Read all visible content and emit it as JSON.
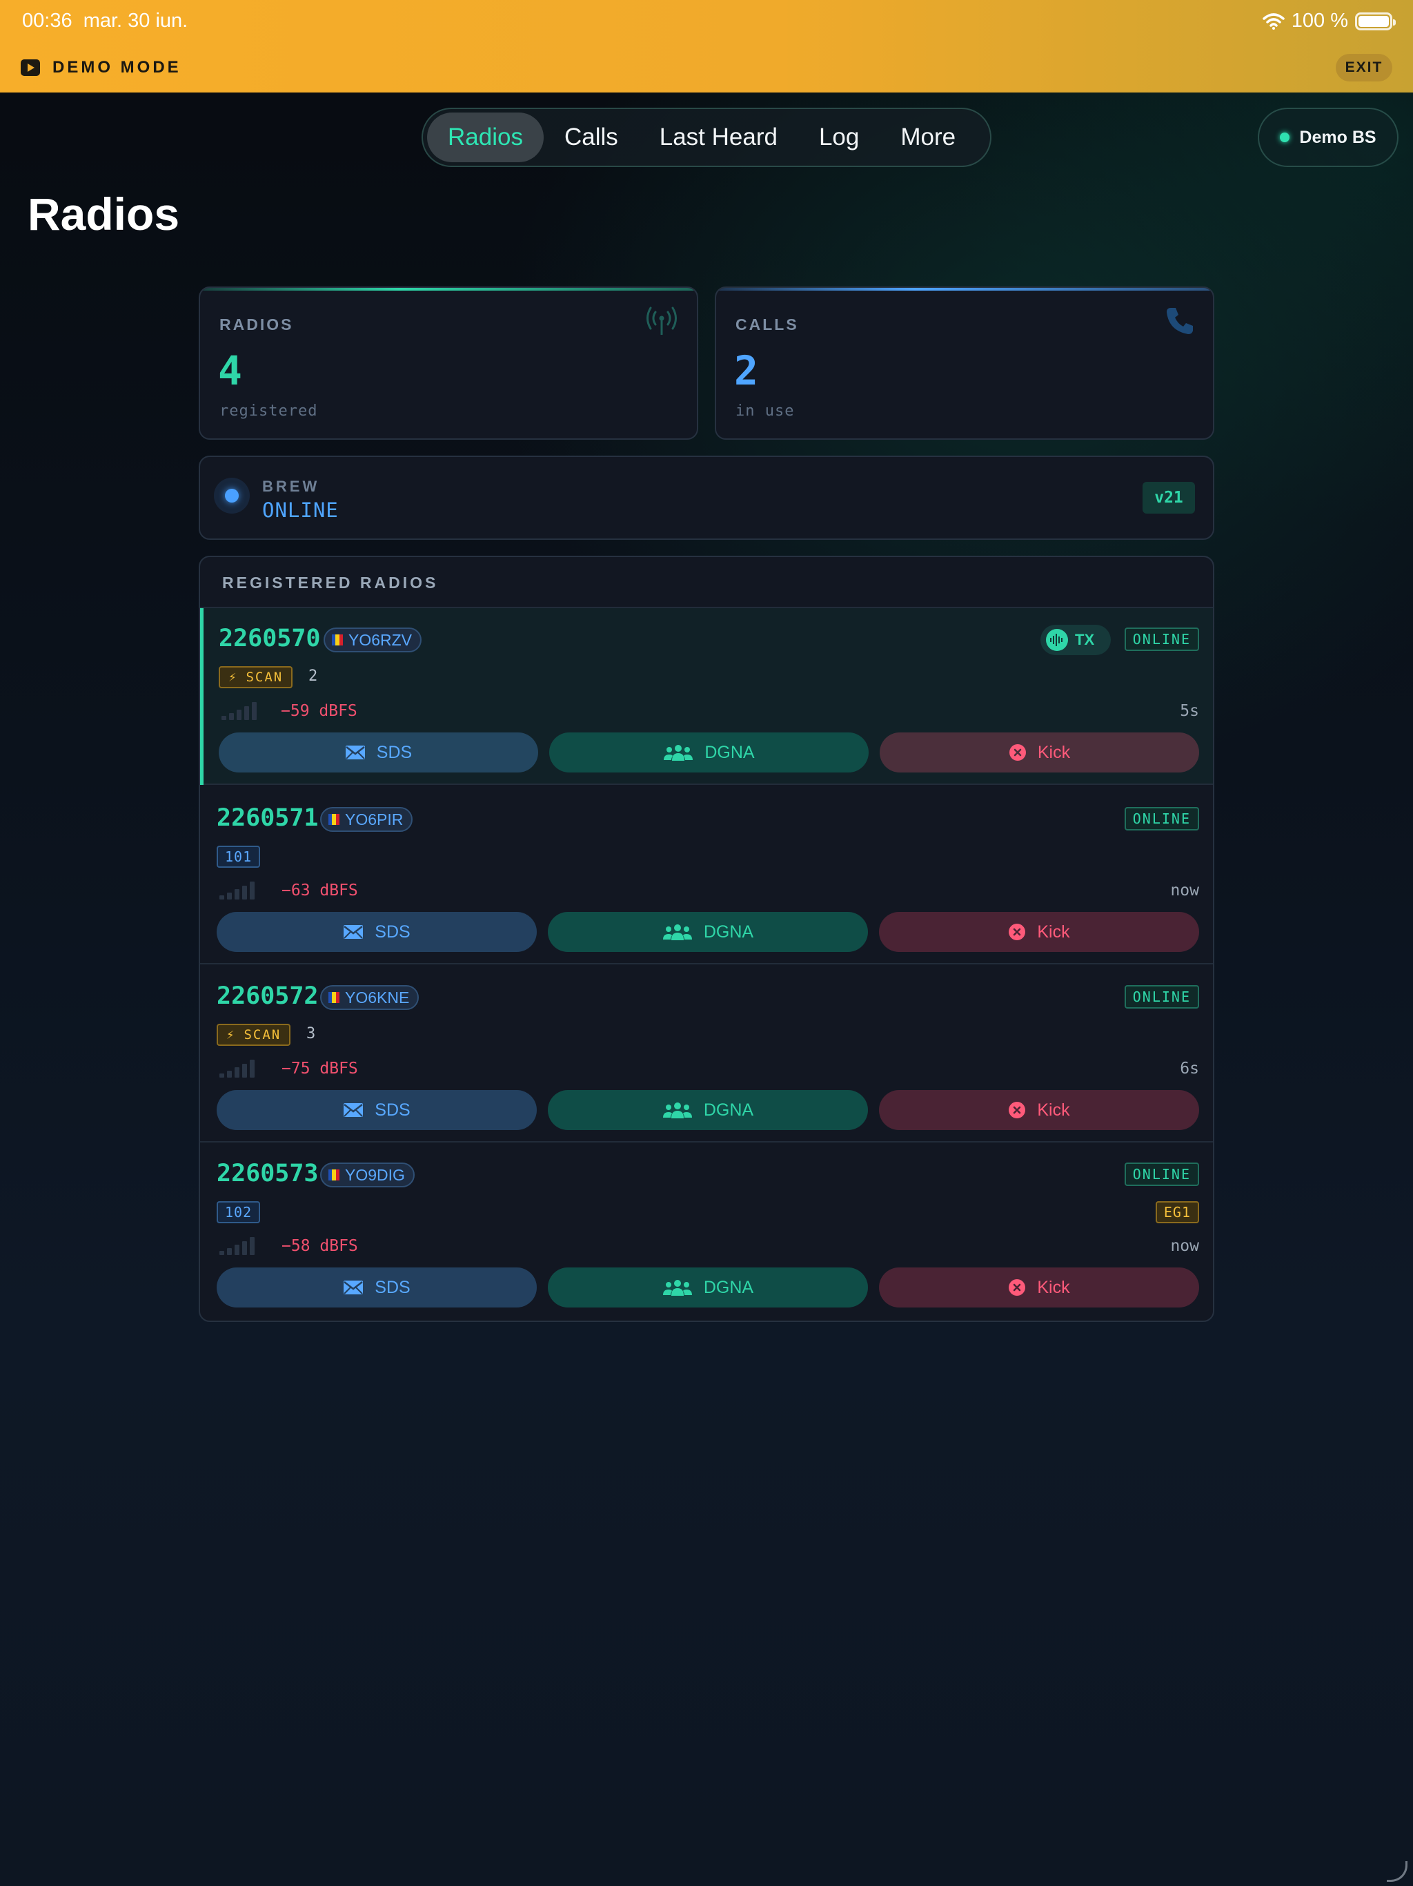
{
  "status_bar": {
    "time": "00:36",
    "date": "mar. 30 iun.",
    "battery": "100 %"
  },
  "demo": {
    "label": "DEMO MODE",
    "exit_label": "EXIT"
  },
  "nav": {
    "tabs": [
      {
        "label": "Radios",
        "active": true
      },
      {
        "label": "Calls"
      },
      {
        "label": "Last Heard"
      },
      {
        "label": "Log"
      },
      {
        "label": "More"
      }
    ]
  },
  "base_station": {
    "label": "Demo BS"
  },
  "page": {
    "title": "Radios"
  },
  "stats": {
    "radios": {
      "label": "RADIOS",
      "value": "4",
      "sub": "registered",
      "icon": "antenna-icon",
      "color": "#2fd6a8"
    },
    "calls": {
      "label": "CALLS",
      "value": "2",
      "sub": "in use",
      "icon": "phone-icon",
      "color": "#4fa5ff"
    }
  },
  "brew": {
    "label": "BREW",
    "status": "ONLINE",
    "version": "v21"
  },
  "registered": {
    "title": "REGISTERED RADIOS",
    "radios": [
      {
        "id": "2260570",
        "callsign": "YO6RZV",
        "tx": "TX",
        "status": "ONLINE",
        "scan": "SCAN",
        "scan_count": "2",
        "dbfs": "−59 dBFS",
        "age": "5s",
        "sds": "SDS",
        "dgna": "DGNA",
        "kick": "Kick"
      },
      {
        "id": "2260571",
        "callsign": "YO6PIR",
        "status": "ONLINE",
        "group": "101",
        "dbfs": "−63 dBFS",
        "age": "now",
        "sds": "SDS",
        "dgna": "DGNA",
        "kick": "Kick"
      },
      {
        "id": "2260572",
        "callsign": "YO6KNE",
        "status": "ONLINE",
        "scan": "SCAN",
        "scan_count": "3",
        "dbfs": "−75 dBFS",
        "age": "6s",
        "sds": "SDS",
        "dgna": "DGNA",
        "kick": "Kick"
      },
      {
        "id": "2260573",
        "callsign": "YO9DIG",
        "status": "ONLINE",
        "group": "102",
        "eg": "EG1",
        "dbfs": "−58 dBFS",
        "age": "now",
        "sds": "SDS",
        "dgna": "DGNA",
        "kick": "Kick"
      }
    ]
  }
}
